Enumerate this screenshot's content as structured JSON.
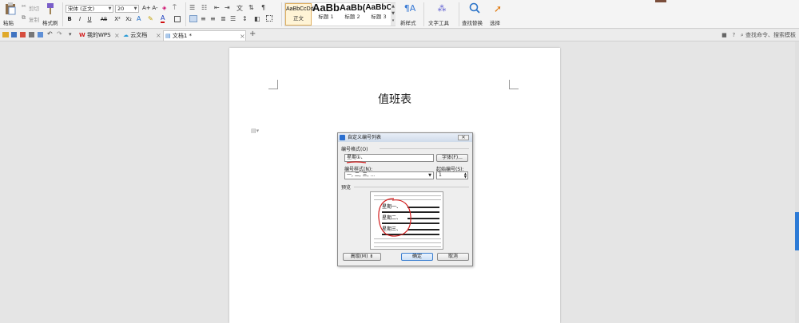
{
  "ribbon": {
    "paste_label": "粘贴",
    "cut_label": "剪切",
    "copy_label": "复制",
    "format_painter_label": "格式刷",
    "font_name": "宋体 (正文)",
    "font_size": "20",
    "grow_font": "A+",
    "shrink_font": "A-",
    "bold": "B",
    "italic": "I",
    "underline": "U",
    "strike": "AB",
    "superscript": "X²",
    "subscript": "X₂",
    "styles": [
      {
        "sample": "AaBbCcDd",
        "name": "正文"
      },
      {
        "sample": "AaBb",
        "name": "标题 1"
      },
      {
        "sample": "AaBb(",
        "name": "标题 2"
      },
      {
        "sample": "AaBbC",
        "name": "标题 3"
      }
    ],
    "new_style_label": "新样式",
    "text_tools_label": "文字工具",
    "find_replace_label": "查找替换",
    "select_label": "选择"
  },
  "tabs": [
    {
      "label": "我的WPS"
    },
    {
      "label": "云文档"
    },
    {
      "label": "文档1 *"
    }
  ],
  "search_placeholder": "查找命令、搜索模板",
  "document": {
    "title": "值班表"
  },
  "dialog": {
    "title": "自定义编号列表",
    "format_section": "编号格式(O)",
    "format_value": "星期①、",
    "font_button": "字体(F)...",
    "style_label": "编号样式(N):",
    "style_value": "一, 二, 三, ...",
    "start_label": "起始编号(S):",
    "start_value": "1",
    "preview_label": "预览",
    "preview_items": [
      "星期一、",
      "星期二、",
      "星期三、"
    ],
    "advanced_button": "高级(M) ⇟",
    "ok_button": "确定",
    "cancel_button": "取消"
  },
  "colors": {
    "accent": "#2d7bd6",
    "annotation_red": "#d42020"
  }
}
